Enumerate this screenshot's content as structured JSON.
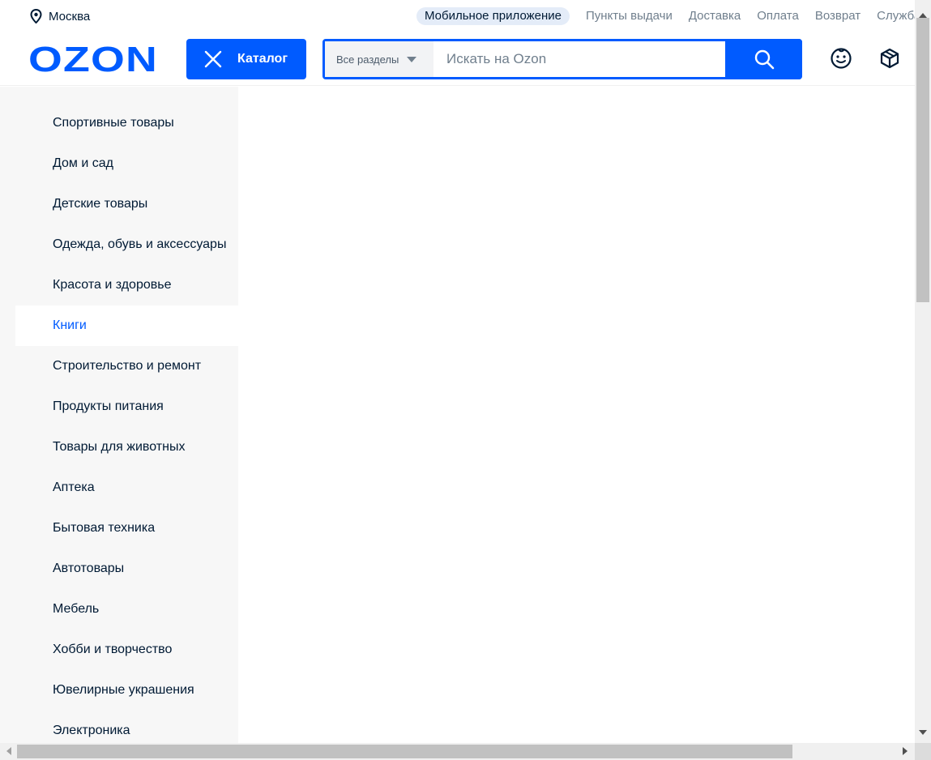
{
  "topbar": {
    "location": "Москва",
    "app_link": "Мобильное приложение",
    "links": [
      "Пункты выдачи",
      "Доставка",
      "Оплата",
      "Возврат",
      "Служба поддержки"
    ]
  },
  "header": {
    "logo_text": "OZON",
    "catalog_label": "Каталог",
    "search": {
      "section": "Все разделы",
      "placeholder": "Искать на Ozon"
    }
  },
  "sidebar": {
    "active_index": 5,
    "items": [
      "Спортивные товары",
      "Дом и сад",
      "Детские товары",
      "Одежда, обувь и аксессуары",
      "Красота и здоровье",
      "Книги",
      "Строительство и ремонт",
      "Продукты питания",
      "Товары для животных",
      "Аптека",
      "Бытовая техника",
      "Автотовары",
      "Мебель",
      "Хобби и творчество",
      "Ювелирные украшения",
      "Электроника"
    ]
  },
  "colors": {
    "brand": "#005bff",
    "text": "#001a34",
    "muted": "#707f8d",
    "sidebar_bg": "#f7f7f7"
  },
  "icons": {
    "location": "map-pin-icon",
    "close": "close-icon",
    "search": "search-icon",
    "face": "smiley-icon",
    "box": "package-icon",
    "caret": "caret-down-icon"
  }
}
